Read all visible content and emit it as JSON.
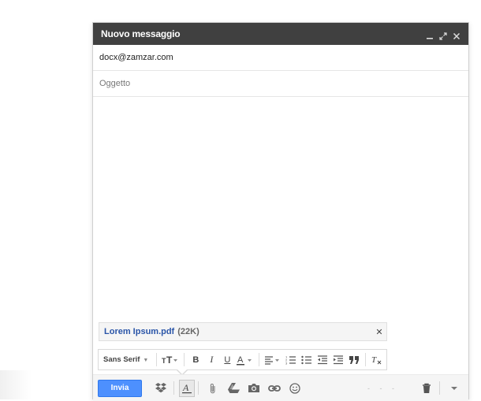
{
  "window": {
    "title": "Nuovo messaggio"
  },
  "fields": {
    "to_value": "docx@zamzar.com",
    "subject_placeholder": "Oggetto"
  },
  "attachment": {
    "name": "Lorem Ipsum.pdf",
    "size": "(22K)"
  },
  "format_bar": {
    "font": "Sans Serif",
    "buttons": [
      "font-size",
      "bold",
      "italic",
      "underline",
      "text-color",
      "align",
      "numbered-list",
      "bulleted-list",
      "indent-less",
      "indent-more",
      "quote",
      "remove-formatting"
    ]
  },
  "bottom_bar": {
    "send_label": "Invia"
  },
  "colors": {
    "title_bar": "#404040",
    "send_button": "#4d90fe",
    "attachment_link": "#2a55a8"
  }
}
